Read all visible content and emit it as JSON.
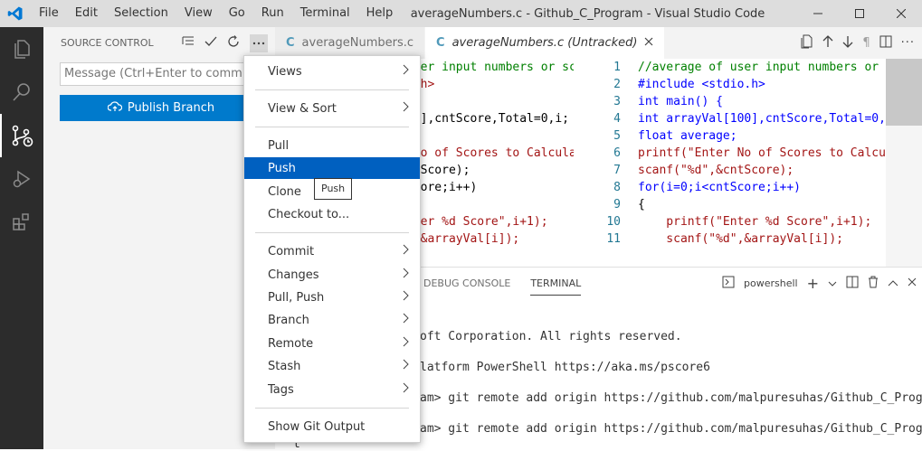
{
  "titlebar": {
    "menu": [
      "File",
      "Edit",
      "Selection",
      "View",
      "Go",
      "Run",
      "Terminal",
      "Help"
    ],
    "title": "averageNumbers.c - Github_C_Program - Visual Studio Code"
  },
  "sidebar": {
    "title": "SOURCE CONTROL",
    "message_placeholder": "Message (Ctrl+Enter to commit on",
    "publish_label": "Publish Branch"
  },
  "tabs": [
    {
      "label": "averageNumbers.c",
      "icon": "C"
    },
    {
      "label": "averageNumbers.c (Untracked)",
      "icon": "C"
    }
  ],
  "editor_left": {
    "lines": [
      {
        "text": "user input numbers or sco"
      },
      {
        "text": "o.h>"
      },
      {
        "text": ""
      },
      {
        "text": "00],cntScore,Total=0,i;"
      },
      {
        "text": ""
      },
      {
        "text": " No of Scores to Calculat"
      },
      {
        "text": "ntScore);"
      },
      {
        "text": "Score;i++)"
      },
      {
        "text": ""
      },
      {
        "text": "nter %d Score\",i+1);"
      },
      {
        "text": "\",&arrayVal[i]);"
      }
    ]
  },
  "editor_right": {
    "line_numbers": [
      "1",
      "2",
      "3",
      "4",
      "5",
      "6",
      "7",
      "8",
      "9",
      "10",
      "11"
    ],
    "lines": [
      "//average of user input numbers or sco",
      "#include <stdio.h>",
      "int main() {",
      "int arrayVal[100],cntScore,Total=0,i;",
      "float average;",
      "printf(\"Enter No of Scores to Calculat",
      "scanf(\"%d\",&cntScore);",
      "for(i=0;i<cntScore;i++)",
      "{",
      "    printf(\"Enter %d Score\",i+1);",
      "    scanf(\"%d\",&arrayVal[i]);"
    ]
  },
  "panel": {
    "tabs": [
      "DEBUG CONSOLE",
      "TERMINAL"
    ],
    "shell": "powershell",
    "terminal_lines": [
      "oft Corporation. All rights reserved.",
      "latform PowerShell https://aka.ms/pscore6",
      "am> git remote add origin https://github.com/malpuresuhas/Github_C_Program.gi",
      "am> git remote add origin https://github.com/malpuresuhas/Github_C_Program.gi",
      "t"
    ]
  },
  "menu": {
    "items": [
      {
        "label": "Views",
        "submenu": true
      },
      {
        "label": "View & Sort",
        "submenu": true
      },
      {
        "label": "Pull",
        "submenu": false
      },
      {
        "label": "Push",
        "submenu": false,
        "selected": true
      },
      {
        "label": "Clone",
        "submenu": false
      },
      {
        "label": "Checkout to...",
        "submenu": false
      },
      {
        "label": "Commit",
        "submenu": true
      },
      {
        "label": "Changes",
        "submenu": true
      },
      {
        "label": "Pull, Push",
        "submenu": true
      },
      {
        "label": "Branch",
        "submenu": true
      },
      {
        "label": "Remote",
        "submenu": true
      },
      {
        "label": "Stash",
        "submenu": true
      },
      {
        "label": "Tags",
        "submenu": true
      },
      {
        "label": "Show Git Output",
        "submenu": false
      }
    ]
  },
  "tooltip": "Push",
  "colors": {
    "accent": "#007acc",
    "selection": "#0060c0",
    "activity_bar": "#2c2c2c"
  }
}
